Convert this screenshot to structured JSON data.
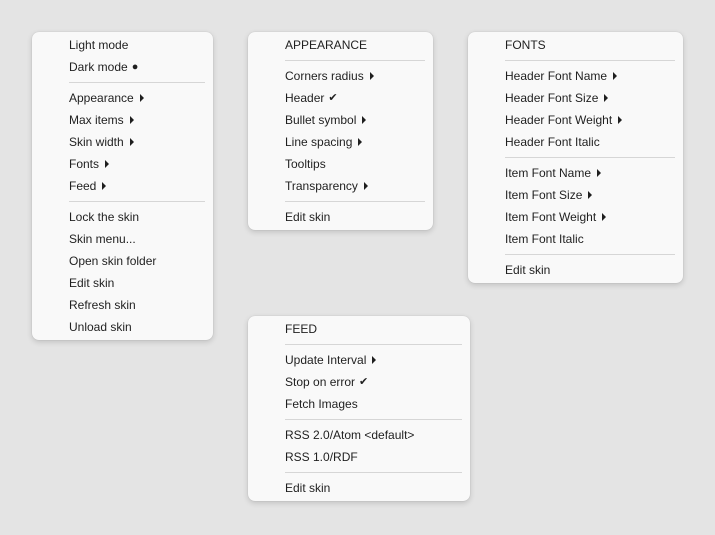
{
  "main_menu": {
    "group1": [
      {
        "label": "Light mode",
        "mark": ""
      },
      {
        "label": "Dark mode",
        "mark": "●"
      }
    ],
    "group2": [
      {
        "label": "Appearance",
        "submenu": true
      },
      {
        "label": "Max items",
        "submenu": true
      },
      {
        "label": "Skin width",
        "submenu": true
      },
      {
        "label": "Fonts",
        "submenu": true
      },
      {
        "label": "Feed",
        "submenu": true
      }
    ],
    "group3": [
      {
        "label": "Lock the skin"
      },
      {
        "label": "Skin menu..."
      },
      {
        "label": "Open skin folder"
      },
      {
        "label": "Edit skin"
      },
      {
        "label": "Refresh skin"
      },
      {
        "label": "Unload skin"
      }
    ]
  },
  "appearance_menu": {
    "header": "APPEARANCE",
    "items": [
      {
        "label": "Corners radius",
        "submenu": true,
        "mark": ""
      },
      {
        "label": "Header",
        "submenu": false,
        "mark": "✔"
      },
      {
        "label": "Bullet symbol",
        "submenu": true,
        "mark": ""
      },
      {
        "label": "Line spacing",
        "submenu": true,
        "mark": ""
      },
      {
        "label": "Tooltips",
        "submenu": false,
        "mark": ""
      },
      {
        "label": "Transparency",
        "submenu": true,
        "mark": ""
      }
    ],
    "footer": "Edit skin"
  },
  "fonts_menu": {
    "header": "FONTS",
    "group1": [
      {
        "label": "Header Font Name",
        "submenu": true
      },
      {
        "label": "Header Font Size",
        "submenu": true
      },
      {
        "label": "Header Font Weight",
        "submenu": true
      },
      {
        "label": "Header Font Italic",
        "submenu": false
      }
    ],
    "group2": [
      {
        "label": "Item Font Name",
        "submenu": true
      },
      {
        "label": "Item Font Size",
        "submenu": true
      },
      {
        "label": "Item Font Weight",
        "submenu": true
      },
      {
        "label": "Item Font Italic",
        "submenu": false
      }
    ],
    "footer": "Edit skin"
  },
  "feed_menu": {
    "header": "FEED",
    "group1": [
      {
        "label": "Update Interval",
        "submenu": true,
        "mark": ""
      },
      {
        "label": "Stop on error",
        "submenu": false,
        "mark": "✔"
      },
      {
        "label": "Fetch Images",
        "submenu": false,
        "mark": ""
      }
    ],
    "group2": [
      {
        "label": "RSS 2.0/Atom <default>"
      },
      {
        "label": "RSS 1.0/RDF"
      }
    ],
    "footer": "Edit skin"
  }
}
